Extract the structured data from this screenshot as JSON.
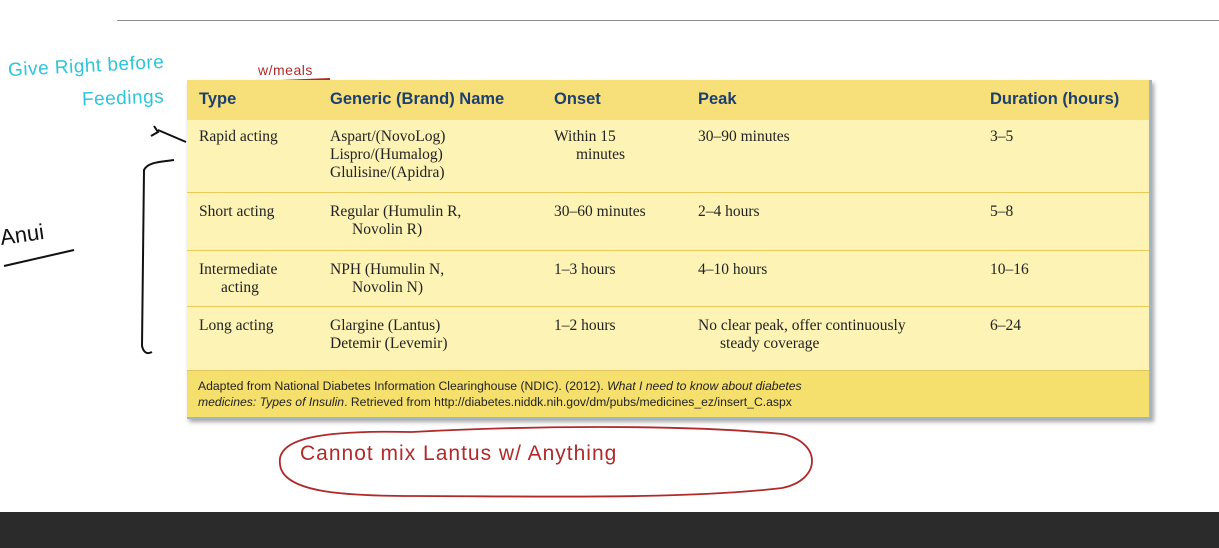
{
  "table": {
    "headers": [
      "Type",
      "Generic (Brand) Name",
      "Onset",
      "Peak",
      "Duration (hours)"
    ],
    "rows": [
      {
        "type": [
          "Rapid acting"
        ],
        "names": [
          "Aspart/(NovoLog)",
          "Lispro/(Humalog)",
          "Glulisine/(Apidra)"
        ],
        "onset": [
          "Within 15",
          "minutes"
        ],
        "peak": [
          "30–90 minutes"
        ],
        "duration": "3–5"
      },
      {
        "type": [
          "Short acting"
        ],
        "names": [
          "Regular (Humulin R,",
          "Novolin R)"
        ],
        "onset": [
          "30–60 minutes"
        ],
        "peak": [
          "2–4 hours"
        ],
        "duration": "5–8"
      },
      {
        "type": [
          "Intermediate",
          "acting"
        ],
        "names": [
          "NPH (Humulin N,",
          "Novolin N)"
        ],
        "onset": [
          "1–3 hours"
        ],
        "peak": [
          "4–10 hours"
        ],
        "duration": "10–16"
      },
      {
        "type": [
          "Long acting"
        ],
        "names": [
          "Glargine (Lantus)",
          "Detemir (Levemir)"
        ],
        "onset": [
          "1–2 hours"
        ],
        "peak": [
          "No clear peak, offer continuously",
          "steady coverage"
        ],
        "duration": "6–24"
      }
    ],
    "footnote": {
      "prefix": "Adapted from National Diabetes Information Clearinghouse (NDIC). (2012). ",
      "italic_title_1": "What I need to know about diabetes",
      "italic_title_2": "medicines: Types of Insulin",
      "suffix": ". Retrieved from http://diabetes.niddk.nih.gov/dm/pubs/medicines_ez/insert_C.aspx"
    }
  },
  "annotations": {
    "give_right_before_1": "Give Right before",
    "give_right_before_2": "Feedings",
    "with_meals": "w/meals",
    "left_word": "Anui",
    "cannot_mix": "Cannot mix Lantus w/ Anything"
  },
  "colors": {
    "header_bg": "#f7e07a",
    "row_bg": "#fdf3b5",
    "header_text": "#1d3f6e",
    "pen_blue": "#2ec4d9",
    "pen_red": "#b02a2a",
    "pen_black": "#111111"
  }
}
